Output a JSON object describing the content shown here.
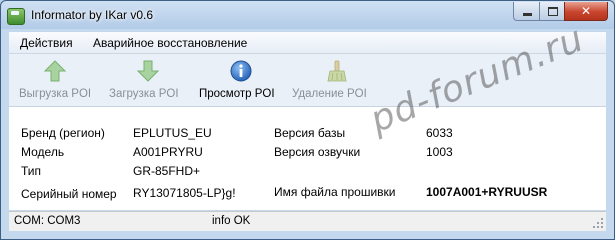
{
  "window": {
    "title": "Informator by IKar v0.6",
    "close_glyph": "✕"
  },
  "menu": {
    "items": [
      "Действия",
      "Аварийное восстановление"
    ]
  },
  "toolbar": {
    "buttons": [
      {
        "label": "Выгрузка POI",
        "icon": "arrow-up-icon",
        "enabled": false
      },
      {
        "label": "Загрузка POI",
        "icon": "arrow-down-icon",
        "enabled": false
      },
      {
        "label": "Просмотр POI",
        "icon": "info-icon",
        "enabled": true
      },
      {
        "label": "Удаление POI",
        "icon": "broom-icon",
        "enabled": false
      }
    ]
  },
  "device": {
    "left": [
      {
        "label": "Бренд (регион)",
        "value": "EPLUTUS_EU"
      },
      {
        "label": "Модель",
        "value": "A001PRYRU"
      },
      {
        "label": "Тип",
        "value": "GR-85FHD+"
      },
      {
        "label": "Серийный номер",
        "value": "RY13071805-LP}g!"
      }
    ],
    "right": [
      {
        "label": "Версия базы",
        "value": "6033"
      },
      {
        "label": "Версия озвучки",
        "value": "1003"
      },
      {
        "label": "Имя файла прошивки",
        "value": "1007A001+RYRUUSR"
      }
    ]
  },
  "status": {
    "port": "COM:  COM3",
    "info": "info OK"
  },
  "watermark": "pd-forum.ru",
  "colors": {
    "arrow_green": "#8fc48a",
    "info_blue": "#2f6fc4",
    "close_red": "#c8452e"
  }
}
